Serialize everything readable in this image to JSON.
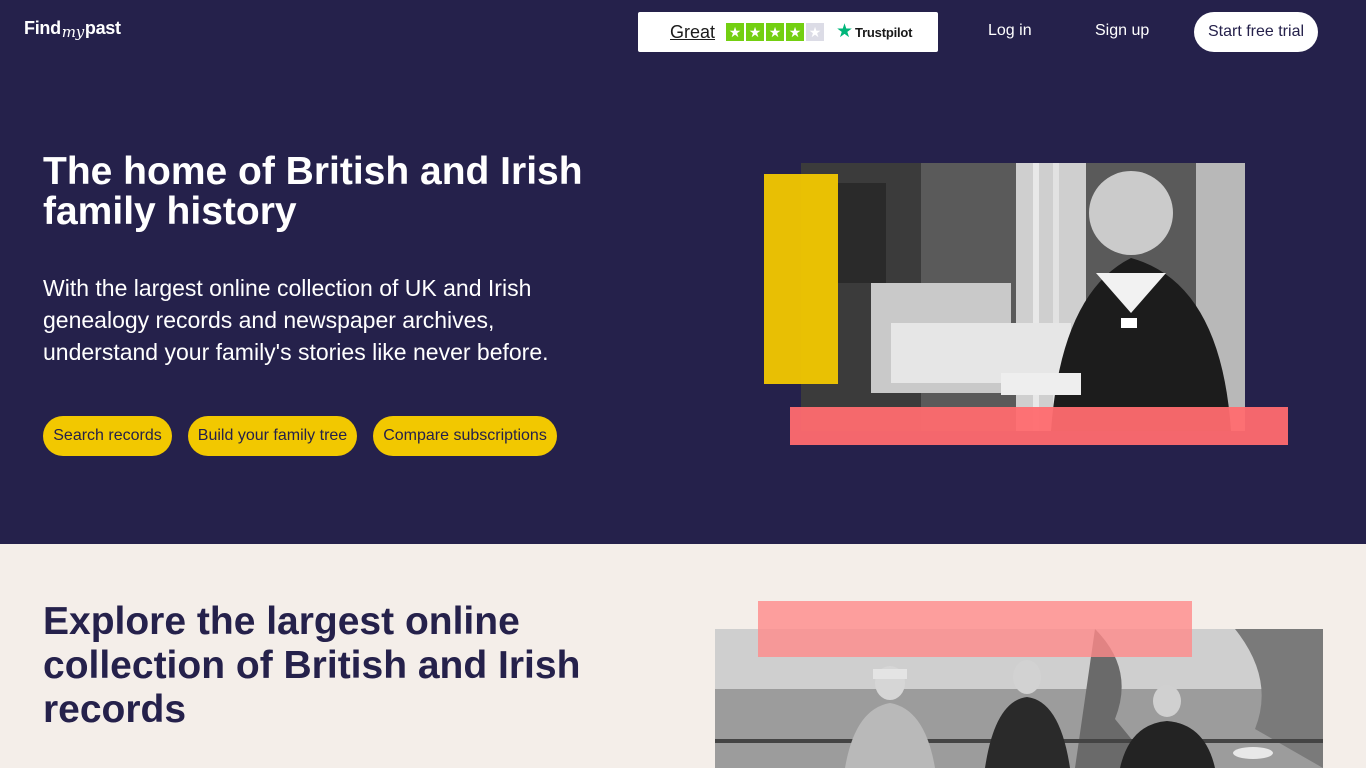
{
  "header": {
    "logo_text": {
      "find": "Find",
      "my": "my",
      "past": "past"
    },
    "trustpilot": {
      "rating_label": "Great",
      "stars_filled": 4,
      "stars_total": 5,
      "brand": "Trustpilot"
    },
    "login_label": "Log in",
    "signup_label": "Sign up",
    "trial_label": "Start free trial"
  },
  "hero": {
    "title": "The home of British and Irish family history",
    "subtitle": "With the largest online collection of UK and Irish genealogy records and newspaper archives, understand your family's stories like never before.",
    "buttons": {
      "search": "Search records",
      "tree": "Build your family tree",
      "compare": "Compare subscriptions"
    }
  },
  "section2": {
    "title": "Explore the largest online collection of British and Irish records"
  },
  "colors": {
    "brand_navy": "#25214b",
    "accent_yellow": "#f2c800",
    "accent_pink": "#ff6b6f",
    "trustpilot_green": "#73cf11",
    "section_bg": "#f4eee9"
  }
}
